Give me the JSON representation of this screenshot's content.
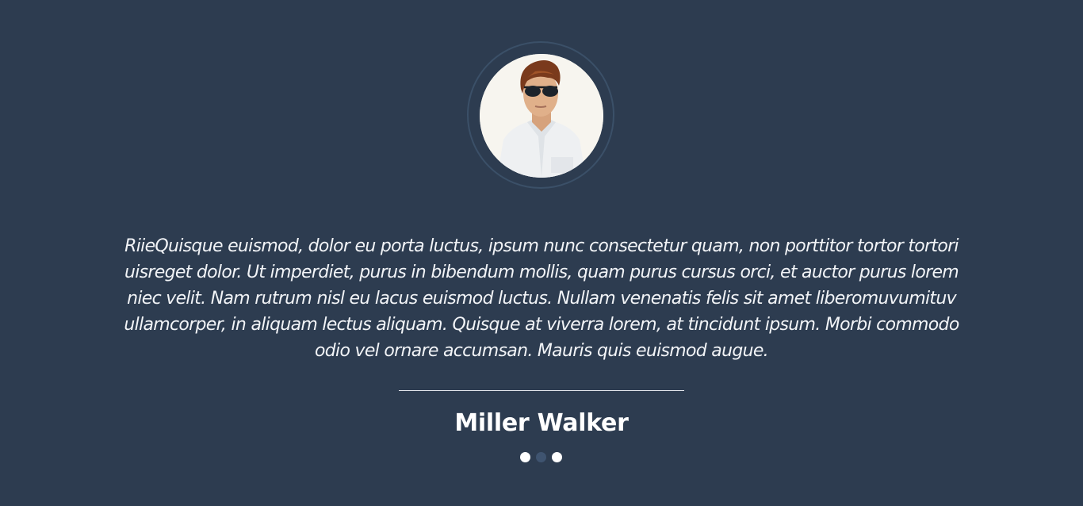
{
  "testimonial": {
    "quote": "RiieQuisque euismod, dolor eu porta luctus, ipsum nunc consectetur quam, non porttitor tortor tortori uisreget dolor. Ut imperdiet, purus in bibendum mollis, quam purus cursus orci, et auctor purus lorem niec velit. Nam rutrum nisl eu lacus euismod luctus. Nullam venenatis felis sit amet liberomuvumituv ullamcorper, in aliquam lectus aliquam. Quisque at viverra lorem, at tincidunt ipsum. Morbi commodo odio vel ornare accumsan. Mauris quis euismod augue.",
    "author": "Miller Walker"
  },
  "carousel": {
    "slide_count": 3,
    "active_slide": 2
  },
  "colors": {
    "background": "#2d3c50",
    "ring": "#3b5068",
    "text": "#ffffff",
    "dot_active": "#ffffff",
    "dot_inactive": "#3f5470"
  }
}
